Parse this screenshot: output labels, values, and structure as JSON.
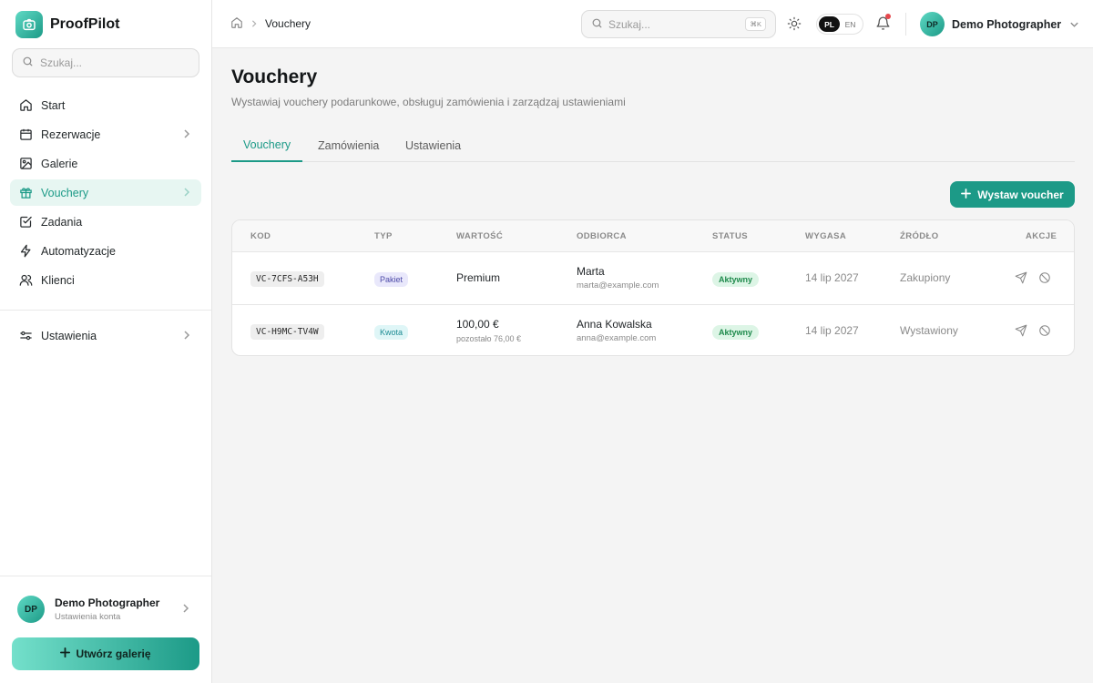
{
  "app": {
    "name": "ProofPilot"
  },
  "sidebar": {
    "search_placeholder": "Szukaj...",
    "items": [
      {
        "label": "Start",
        "icon": "home-icon"
      },
      {
        "label": "Rezerwacje",
        "icon": "calendar-icon",
        "has_children": true
      },
      {
        "label": "Galerie",
        "icon": "image-icon"
      },
      {
        "label": "Vouchery",
        "icon": "gift-icon",
        "has_children": true,
        "active": true
      },
      {
        "label": "Zadania",
        "icon": "checkbox-icon"
      },
      {
        "label": "Automatyzacje",
        "icon": "zap-icon"
      },
      {
        "label": "Klienci",
        "icon": "users-icon"
      }
    ],
    "settings": {
      "label": "Ustawienia",
      "icon": "sliders-icon"
    },
    "user": {
      "initials": "DP",
      "name": "Demo Photographer",
      "subtitle": "Ustawienia konta"
    },
    "create_button": "Utwórz galerię"
  },
  "topbar": {
    "breadcrumb": {
      "current": "Vouchery"
    },
    "search_placeholder": "Szukaj...",
    "shortcut": "⌘K",
    "lang": {
      "active": "PL",
      "other": "EN"
    },
    "user": {
      "initials": "DP",
      "name": "Demo Photographer"
    }
  },
  "page": {
    "title": "Vouchery",
    "subtitle": "Wystawiaj vouchery podarunkowe, obsługuj zamówienia i zarządzaj ustawieniami",
    "tabs": [
      {
        "label": "Vouchery",
        "active": true
      },
      {
        "label": "Zamówienia"
      },
      {
        "label": "Ustawienia"
      }
    ],
    "add_button": "Wystaw voucher"
  },
  "table": {
    "columns": [
      "KOD",
      "TYP",
      "WARTOŚĆ",
      "ODBIORCA",
      "STATUS",
      "WYGASA",
      "ŹRÓDŁO",
      "AKCJE"
    ],
    "rows": [
      {
        "code": "VC-7CFS-A53H",
        "type": "Pakiet",
        "value": "Premium",
        "value_sub": "",
        "recipient_name": "Marta",
        "recipient_email": "marta@example.com",
        "status": "Aktywny",
        "expires": "14 lip 2027",
        "source": "Zakupiony"
      },
      {
        "code": "VC-H9MC-TV4W",
        "type": "Kwota",
        "value": "100,00 €",
        "value_sub": "pozostało 76,00 €",
        "recipient_name": "Anna Kowalska",
        "recipient_email": "anna@example.com",
        "status": "Aktywny",
        "expires": "14 lip 2027",
        "source": "Wystawiony"
      }
    ]
  },
  "colors": {
    "accent": "#1c9a87",
    "active_bg": "#e7f6f2",
    "status_green": "#1f8a4c",
    "notification": "#e5484d"
  }
}
